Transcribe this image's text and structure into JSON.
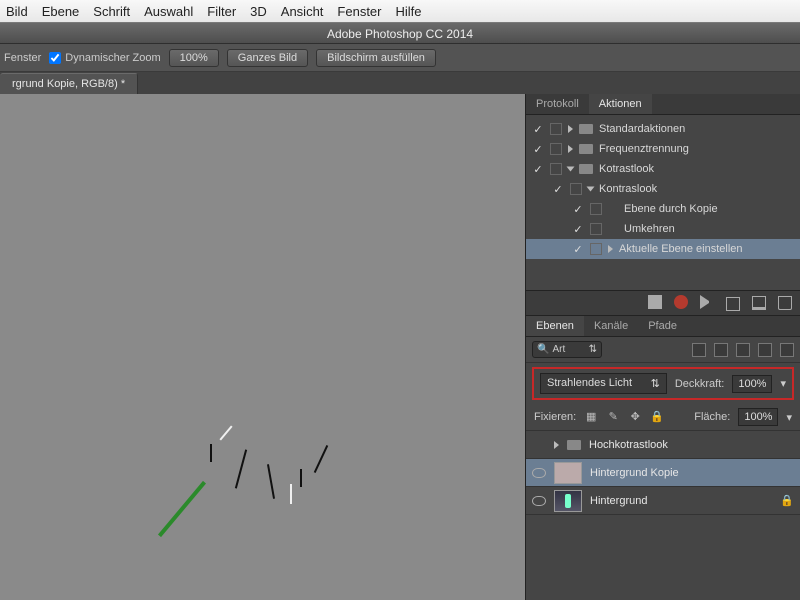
{
  "menubar": [
    "Bild",
    "Ebene",
    "Schrift",
    "Auswahl",
    "Filter",
    "3D",
    "Ansicht",
    "Fenster",
    "Hilfe"
  ],
  "app_title": "Adobe Photoshop CC 2014",
  "options": {
    "scroll_label": "Fenster",
    "dynzoom_label": "Dynamischer Zoom",
    "zoom_val": "100%",
    "fit_label": "Ganzes Bild",
    "fill_label": "Bildschirm ausfüllen"
  },
  "doc_tab": "rgrund Kopie, RGB/8) *",
  "actions_panel": {
    "tabs": [
      "Protokoll",
      "Aktionen"
    ],
    "active_tab": 1,
    "rows": [
      {
        "label": "Standardaktionen",
        "depth": 1,
        "folder": true,
        "open": false
      },
      {
        "label": "Frequenztrennung",
        "depth": 1,
        "folder": true,
        "open": false
      },
      {
        "label": "Kotrastlook",
        "depth": 1,
        "folder": true,
        "open": true
      },
      {
        "label": "Kontraslook",
        "depth": 2,
        "folder": false,
        "open": true
      },
      {
        "label": "Ebene durch Kopie",
        "depth": 3,
        "folder": false
      },
      {
        "label": "Umkehren",
        "depth": 3,
        "folder": false
      },
      {
        "label": "Aktuelle Ebene einstellen",
        "depth": 3,
        "folder": false,
        "expandable": true,
        "selected": true
      }
    ]
  },
  "layers_panel": {
    "tabs": [
      "Ebenen",
      "Kanäle",
      "Pfade"
    ],
    "active_tab": 0,
    "search_label": "Art",
    "blend_mode": "Strahlendes Licht",
    "opacity_label": "Deckkraft:",
    "opacity_val": "100%",
    "fix_label": "Fixieren:",
    "fill_label": "Fläche:",
    "fill_val": "100%",
    "layers": [
      {
        "name": "Hochkotrastlook",
        "type": "group",
        "visible": false
      },
      {
        "name": "Hintergrund Kopie",
        "type": "layer",
        "visible": true,
        "selected": true,
        "thumb": "kopie"
      },
      {
        "name": "Hintergrund",
        "type": "layer",
        "visible": true,
        "locked": true,
        "thumb": "bg"
      }
    ]
  }
}
